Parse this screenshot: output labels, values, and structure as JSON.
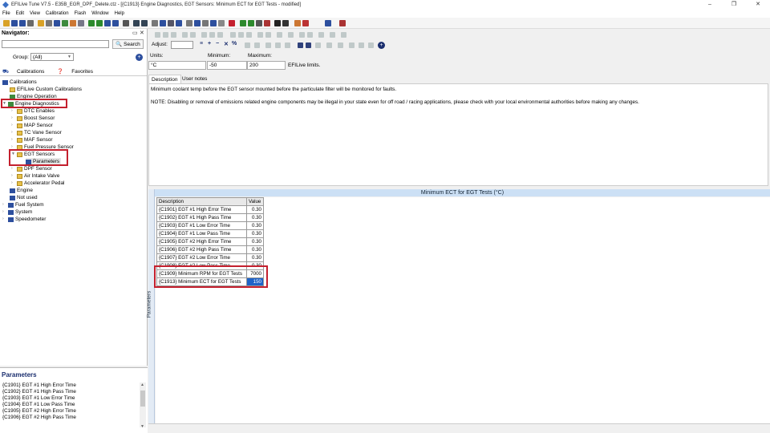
{
  "window": {
    "title": "EFILive Tune V7.5 - E35B_EGR_DPF_Delete.ctz - [{C1913} Engine Diagnostics, EGT Sensors: Minimum ECT for EGT Tests - modified]",
    "controls": [
      "–",
      "❐",
      "✕"
    ]
  },
  "menu": [
    "File",
    "Edit",
    "View",
    "Calibration",
    "Flash",
    "Window",
    "Help"
  ],
  "navigator": {
    "title": "Navigator:",
    "close": "✕",
    "search_value": "",
    "search_button": "Search",
    "group_label": "Group:",
    "group_value": "(All)",
    "tabs": [
      "Calibrations",
      "Favorites"
    ],
    "tree": [
      {
        "label": "Calibrations",
        "level": 0
      },
      {
        "label": "EFILive Custom Calibrations",
        "level": 1
      },
      {
        "label": "Engine Operation",
        "level": 1
      },
      {
        "label": "Engine Diagnostics",
        "level": 1
      },
      {
        "label": "DTC Enables",
        "level": 2
      },
      {
        "label": "Boost Sensor",
        "level": 2
      },
      {
        "label": "MAP Sensor",
        "level": 2
      },
      {
        "label": "TC Vane Sensor",
        "level": 2
      },
      {
        "label": "MAF Sensor",
        "level": 2
      },
      {
        "label": "Fuel Pressure Sensor",
        "level": 2
      },
      {
        "label": "EGT Sensors",
        "level": 2
      },
      {
        "label": "Parameters",
        "level": 3
      },
      {
        "label": "DPF Sensor",
        "level": 2
      },
      {
        "label": "Air Intake Valve",
        "level": 2
      },
      {
        "label": "Accelerator Pedal",
        "level": 2
      },
      {
        "label": "Engine",
        "level": 1
      },
      {
        "label": "Not used",
        "level": 1
      },
      {
        "label": "Fuel System",
        "level": 1
      },
      {
        "label": "System",
        "level": 1
      },
      {
        "label": "Speedometer",
        "level": 1
      }
    ]
  },
  "parameters_panel": {
    "title": "Parameters",
    "items": [
      "{C1901} EGT #1 High Error Time",
      "{C1902} EGT #1 High Pass Time",
      "{C1903} EGT #1 Low Error Time",
      "{C1904} EGT #1 Low Pass Time",
      "{C1905} EGT #2 High Error Time",
      "{C1906} EGT #2 High Pass Time"
    ]
  },
  "toolbar2": {
    "adjust_label": "Adjust:",
    "adjust_value": ""
  },
  "units": {
    "units_label": "Units:",
    "units_value": "°C",
    "min_label": "Minimum:",
    "min_value": "-50",
    "max_label": "Maximum:",
    "max_value": "200",
    "source": "EFILive limits."
  },
  "description": {
    "tabs": [
      "Description",
      "User notes"
    ],
    "line1": "Minimum coolant temp before the EGT sensor mounted before the particulate filter will be monitored for faults.",
    "line2": "NOTE: Disabling or removal of emissions related engine components may be illegal in your state even for off road / racing applications, please check with your local environmental authorities before making any changes."
  },
  "grid": {
    "header": "Minimum ECT for EGT Tests (°C)",
    "side_label": "Parameters",
    "col_description": "Description",
    "col_value": "Value",
    "rows": [
      {
        "desc": "{C1901} EGT #1 High Error Time",
        "value": "0.30"
      },
      {
        "desc": "{C1902} EGT #1 High Pass Time",
        "value": "0.30"
      },
      {
        "desc": "{C1903} EGT #1 Low Error Time",
        "value": "0.30"
      },
      {
        "desc": "{C1904} EGT #1 Low Pass Time",
        "value": "0.30"
      },
      {
        "desc": "{C1905} EGT #2 High Error Time",
        "value": "0.30"
      },
      {
        "desc": "{C1906} EGT #2 High Pass Time",
        "value": "0.30"
      },
      {
        "desc": "{C1907} EGT #2 Low Error Time",
        "value": "0.30"
      },
      {
        "desc": "{C1908} EGT #2 Low Pass Time",
        "value": "0.30"
      },
      {
        "desc": "{C1909} Minimum RPM for EGT Tests",
        "value": "7000"
      },
      {
        "desc": "{C1913} Minimum ECT for EGT Tests",
        "value": "150"
      }
    ],
    "selected_index": 9
  },
  "colors": {
    "highlight": "#c4202e",
    "selection": "#1f63c8",
    "grid_header": "#cce0f5"
  }
}
